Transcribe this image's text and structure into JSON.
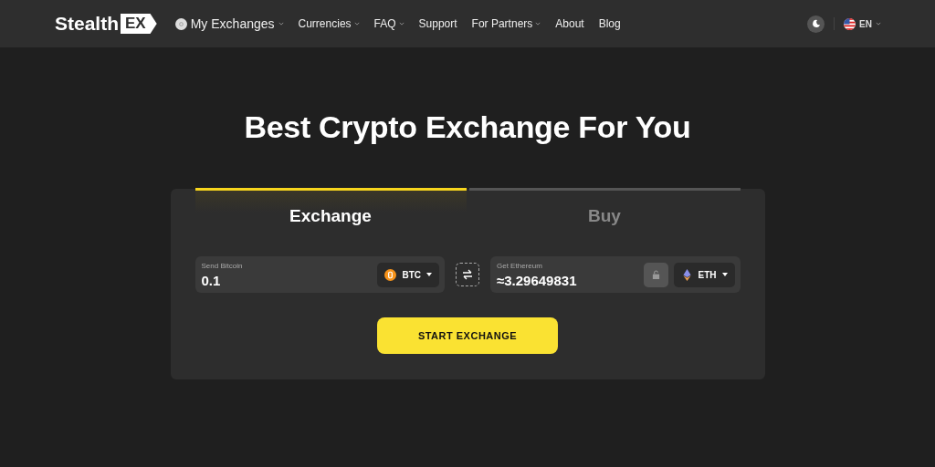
{
  "logo": {
    "text": "Stealth",
    "badge": "EX"
  },
  "nav": [
    {
      "label": "My Exchanges",
      "dropdown": true,
      "kind": "account"
    },
    {
      "label": "Currencies",
      "dropdown": true,
      "kind": "link"
    },
    {
      "label": "FAQ",
      "dropdown": true,
      "kind": "link"
    },
    {
      "label": "Support",
      "dropdown": false,
      "kind": "link"
    },
    {
      "label": "For Partners",
      "dropdown": true,
      "kind": "link"
    },
    {
      "label": "About",
      "dropdown": false,
      "kind": "link"
    },
    {
      "label": "Blog",
      "dropdown": false,
      "kind": "link"
    }
  ],
  "language": "EN",
  "heading": "Best Crypto Exchange For You",
  "tabs": [
    {
      "label": "Exchange",
      "selected": true
    },
    {
      "label": "Buy",
      "selected": false
    }
  ],
  "send": {
    "label": "Send Bitcoin",
    "value": "0.1",
    "currency": "BTC"
  },
  "get": {
    "label": "Get Ethereum",
    "value": "≈3.29649831",
    "currency": "ETH"
  },
  "button": "START EXCHANGE"
}
